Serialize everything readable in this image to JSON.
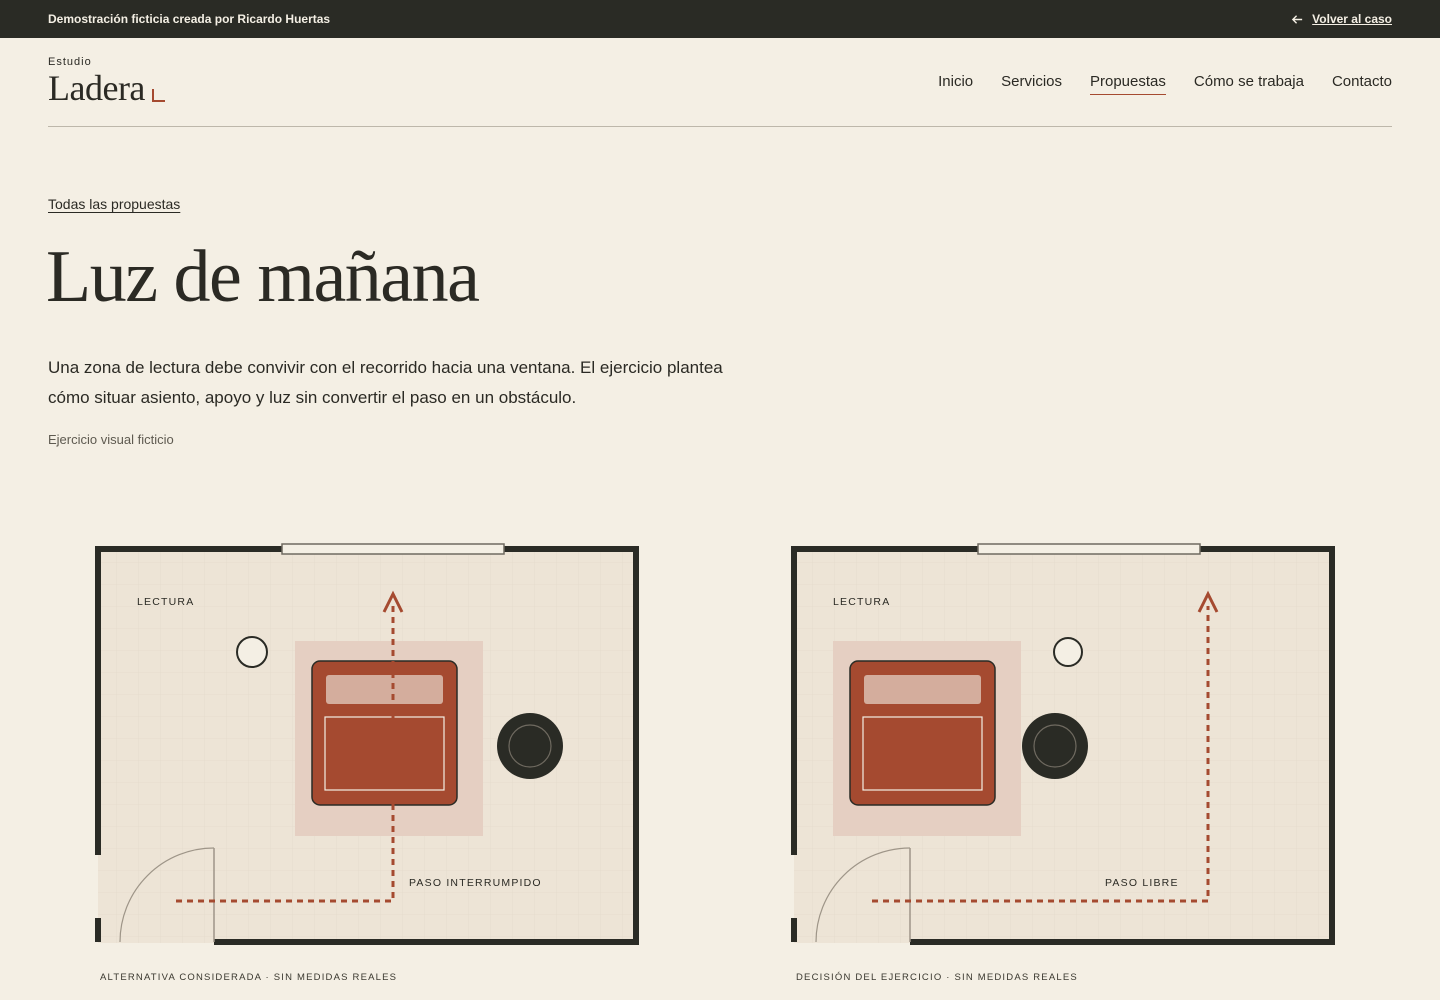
{
  "topbar": {
    "notice": "Demostración ficticia creada por Ricardo Huertas",
    "back_label": "Volver al caso",
    "back_icon": "arrow-left-icon"
  },
  "logo": {
    "small": "Estudio",
    "name": "Ladera"
  },
  "nav": {
    "items": [
      {
        "label": "Inicio"
      },
      {
        "label": "Servicios"
      },
      {
        "label": "Propuestas",
        "active": true
      },
      {
        "label": "Cómo se trabaja"
      },
      {
        "label": "Contacto"
      }
    ]
  },
  "breadcrumb": "Todas las propuestas",
  "title": "Luz de mañana",
  "lead": "Una zona de lectura debe convivir con el recorrido hacia una ventana. El ejercicio plantea cómo situar asiento, apoyo y luz sin convertir el paso en un obstáculo.",
  "note": "Ejercicio visual ficticio",
  "plans": [
    {
      "zone_label": "LECTURA",
      "path_label": "PASO INTERRUMPIDO",
      "caption": "ALTERNATIVA CONSIDERADA · SIN MEDIDAS REALES"
    },
    {
      "zone_label": "LECTURA",
      "path_label": "PASO LIBRE",
      "caption": "DECISIÓN DEL EJERCICIO · SIN MEDIDAS REALES"
    }
  ],
  "colors": {
    "dark": "#2a2b25",
    "accent": "#a54a30",
    "background": "#f4efe4",
    "floor": "#ede4d6",
    "rug": "#e5cfc2"
  }
}
